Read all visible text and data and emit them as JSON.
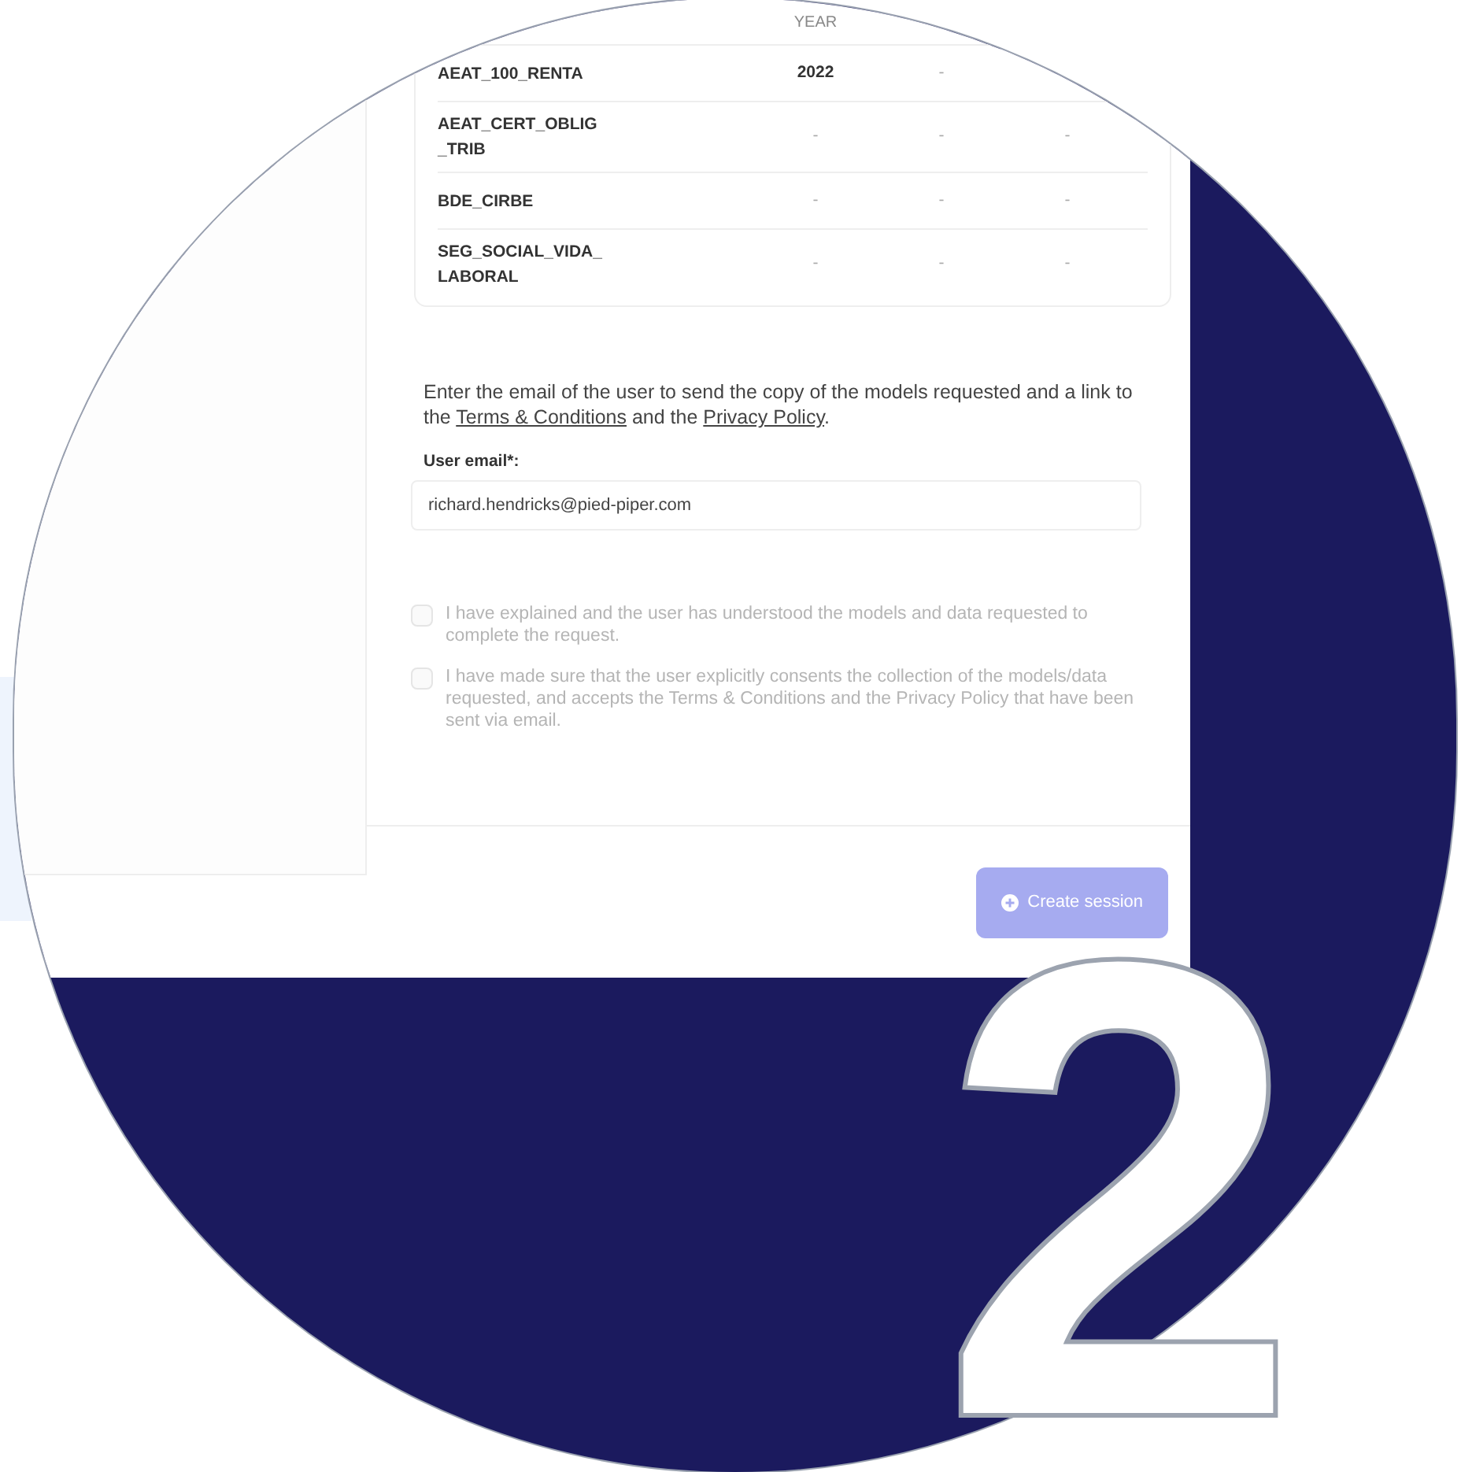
{
  "table": {
    "header": {
      "column_2": "YEAR"
    },
    "rows": [
      {
        "cells": [
          "AEAT_100_RENTA",
          "2022",
          "-"
        ]
      },
      {
        "cells": [
          "AEAT_CERT_OBLIG\n_TRIB",
          "-",
          "-",
          "-"
        ]
      },
      {
        "cells": [
          "BDE_CIRBE",
          "-",
          "-",
          "-"
        ]
      },
      {
        "cells": [
          "SEG_SOCIAL_VIDA_\nLABORAL",
          "-",
          "-",
          "-"
        ]
      }
    ]
  },
  "instructions": [
    {
      "kind": "text",
      "text": "Enter the email of the user to send the copy of the models requested and a link to the "
    },
    {
      "kind": "link",
      "text": "Terms & Conditions"
    },
    {
      "kind": "text",
      "text": " and the "
    },
    {
      "kind": "link",
      "text": "Privacy Policy"
    },
    {
      "kind": "text",
      "text": "."
    }
  ],
  "email_field": {
    "label": "User email*:",
    "value": "richard.hendricks@pied-piper.com"
  },
  "consents": [
    {
      "text": "I have explained and the user has understood the models and data requested to complete the request.",
      "checked": false,
      "disabled": true
    },
    {
      "text": "I have made sure that the user explicitly consents the collection of the models/data requested, and accepts the Terms & Conditions and the Privacy Policy that have been sent via email.",
      "checked": false,
      "disabled": true
    }
  ],
  "create_button": {
    "label": "Create session",
    "disabled": true
  },
  "step_number": "2"
}
